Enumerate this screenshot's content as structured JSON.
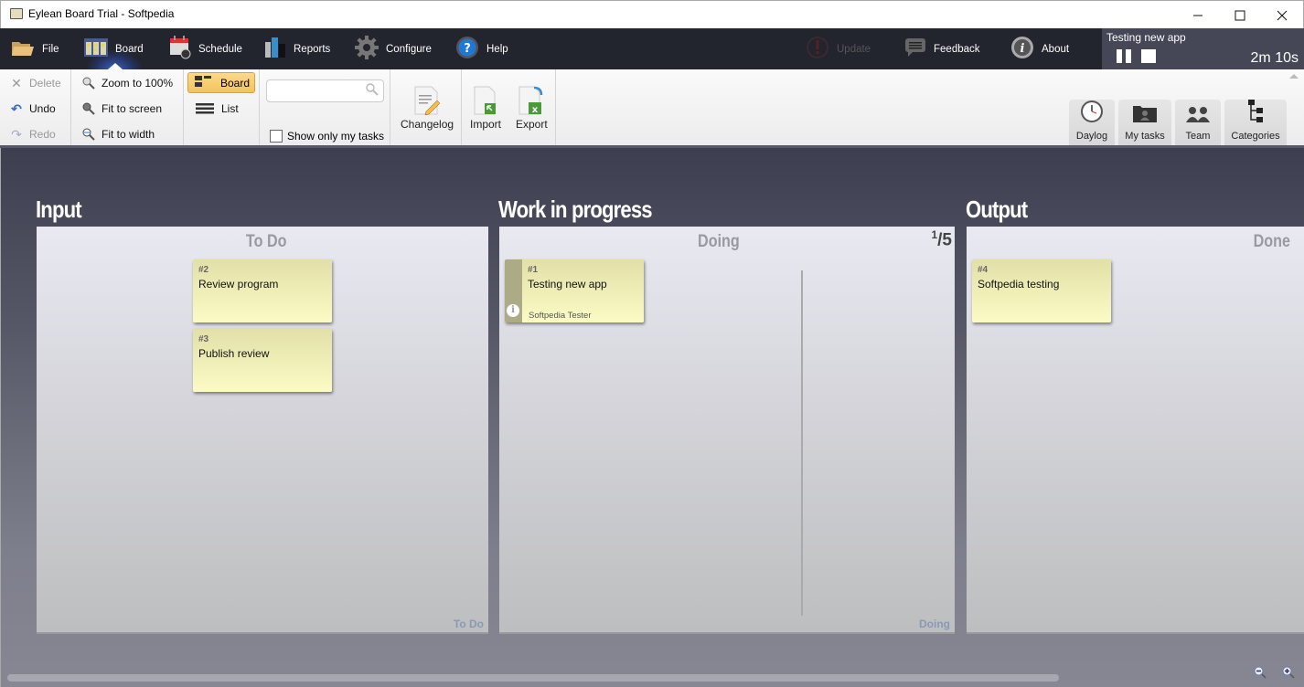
{
  "window": {
    "title": "Eylean Board Trial - Softpedia",
    "controls": {
      "minimize": "—",
      "maximize": "☐",
      "close": "✕"
    }
  },
  "menubar": {
    "items": [
      {
        "id": "file",
        "label": "File",
        "icon": "folder-icon"
      },
      {
        "id": "board",
        "label": "Board",
        "icon": "board-icon",
        "active": true
      },
      {
        "id": "schedule",
        "label": "Schedule",
        "icon": "calendar-icon"
      },
      {
        "id": "reports",
        "label": "Reports",
        "icon": "bar-chart-icon"
      },
      {
        "id": "configure",
        "label": "Configure",
        "icon": "gear-icon"
      },
      {
        "id": "help",
        "label": "Help",
        "icon": "help-icon"
      },
      {
        "id": "update",
        "label": "Update",
        "icon": "alert-icon",
        "disabled": true
      },
      {
        "id": "feedback",
        "label": "Feedback",
        "icon": "speech-bubble-icon"
      },
      {
        "id": "about",
        "label": "About",
        "icon": "info-icon"
      }
    ]
  },
  "timer": {
    "task": "Testing new app",
    "elapsed": "2m 10s"
  },
  "ribbon": {
    "edit": {
      "delete": "Delete",
      "undo": "Undo",
      "redo": "Redo"
    },
    "zoom": {
      "zoom100": "Zoom to 100%",
      "fit_screen": "Fit to screen",
      "fit_width": "Fit to width"
    },
    "view": {
      "board": "Board",
      "list": "List",
      "active": "Board"
    },
    "search": {
      "value": "",
      "placeholder": ""
    },
    "show_only_my_tasks": {
      "label": "Show only my tasks",
      "checked": false
    },
    "changelog": "Changelog",
    "import": "Import",
    "export": "Export",
    "panels": [
      "Daylog",
      "My tasks",
      "Team",
      "Categories"
    ]
  },
  "board": {
    "lanes": [
      {
        "title": "Input",
        "columns": [
          {
            "name": "To Do",
            "cards": [
              {
                "num": "#2",
                "title": "Review program"
              },
              {
                "num": "#3",
                "title": "Publish review"
              }
            ]
          }
        ]
      },
      {
        "title": "Work in progress",
        "wip_current": "1",
        "wip_limit": "/5",
        "columns": [
          {
            "name": "Doing",
            "cards": [
              {
                "num": "#1",
                "title": "Testing new app",
                "assignee": "Softpedia Tester",
                "info": "i"
              }
            ]
          }
        ]
      },
      {
        "title": "Output",
        "columns": [
          {
            "name": "Done",
            "cards": [
              {
                "num": "#4",
                "title": "Softpedia testing"
              }
            ]
          }
        ]
      }
    ]
  },
  "colors": {
    "menubar_bg": "#22242e",
    "timer_bg": "#454757",
    "active_view": "#f4c35c",
    "card_yellow": "#fcfbc5",
    "column_footer": "#8a98b5"
  }
}
